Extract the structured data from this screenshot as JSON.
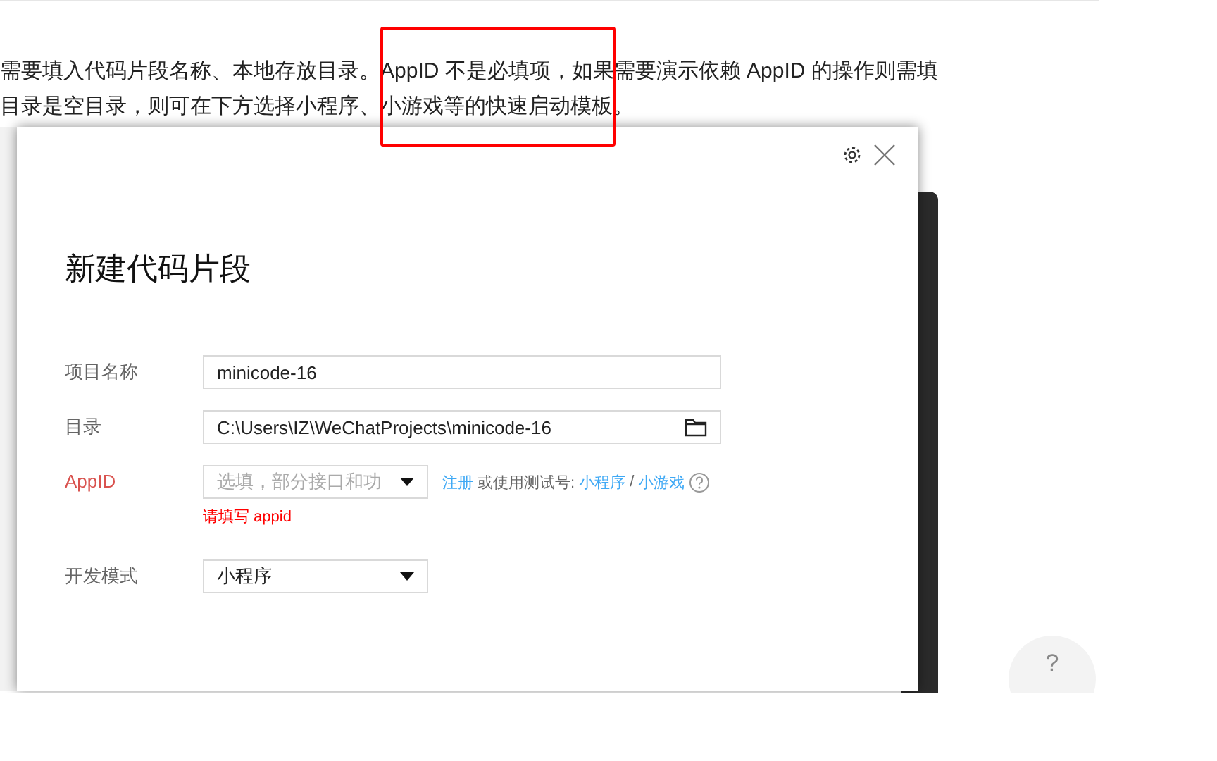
{
  "intro": [
    "需要填入代码片段名称、本地存放目录。AppID 不是必填项，如果需要演示依赖 AppID 的操作则需填",
    "目录是空目录，则可在下方选择小程序、小游戏等的快速启动模板。"
  ],
  "dialog": {
    "title": "新建代码片段",
    "fields": [
      {
        "kind": "text",
        "label": "项目名称",
        "value": "minicode-16",
        "invalid": false
      },
      {
        "kind": "folder",
        "label": "目录",
        "value": "C:\\Users\\IZ\\WeChatProjects\\minicode-16",
        "invalid": false
      },
      {
        "kind": "appid",
        "label": "AppID",
        "placeholder": "选填，部分接口和功",
        "invalid": true,
        "register_link": "注册",
        "hint": "或使用测试号:",
        "links": [
          "小程序",
          "小游戏"
        ],
        "separator": "/",
        "error": "请填写 appid"
      },
      {
        "kind": "select",
        "label": "开发模式",
        "value": "小程序",
        "invalid": false
      }
    ]
  },
  "feedback": {
    "icon_text": "?"
  }
}
